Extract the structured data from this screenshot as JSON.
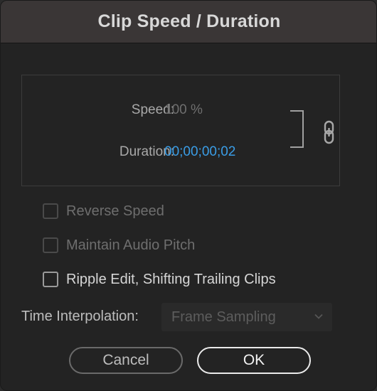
{
  "dialog": {
    "title": "Clip Speed / Duration"
  },
  "speed_section": {
    "speed_label": "Speed:",
    "speed_value": "100 %",
    "duration_label": "Duration:",
    "duration_value": "00;00;00;02",
    "link_icon": "chain-link-icon",
    "duration_color": "#3a9de6"
  },
  "options": {
    "reverse_speed": {
      "label": "Reverse Speed",
      "checked": false,
      "enabled": false
    },
    "maintain_audio_pitch": {
      "label": "Maintain Audio Pitch",
      "checked": false,
      "enabled": false
    },
    "ripple_edit": {
      "label": "Ripple Edit, Shifting Trailing Clips",
      "checked": false,
      "enabled": true
    }
  },
  "time_interpolation": {
    "label": "Time Interpolation:",
    "selected": "Frame Sampling",
    "icon": "chevron-down-icon"
  },
  "buttons": {
    "cancel": "Cancel",
    "ok": "OK"
  }
}
